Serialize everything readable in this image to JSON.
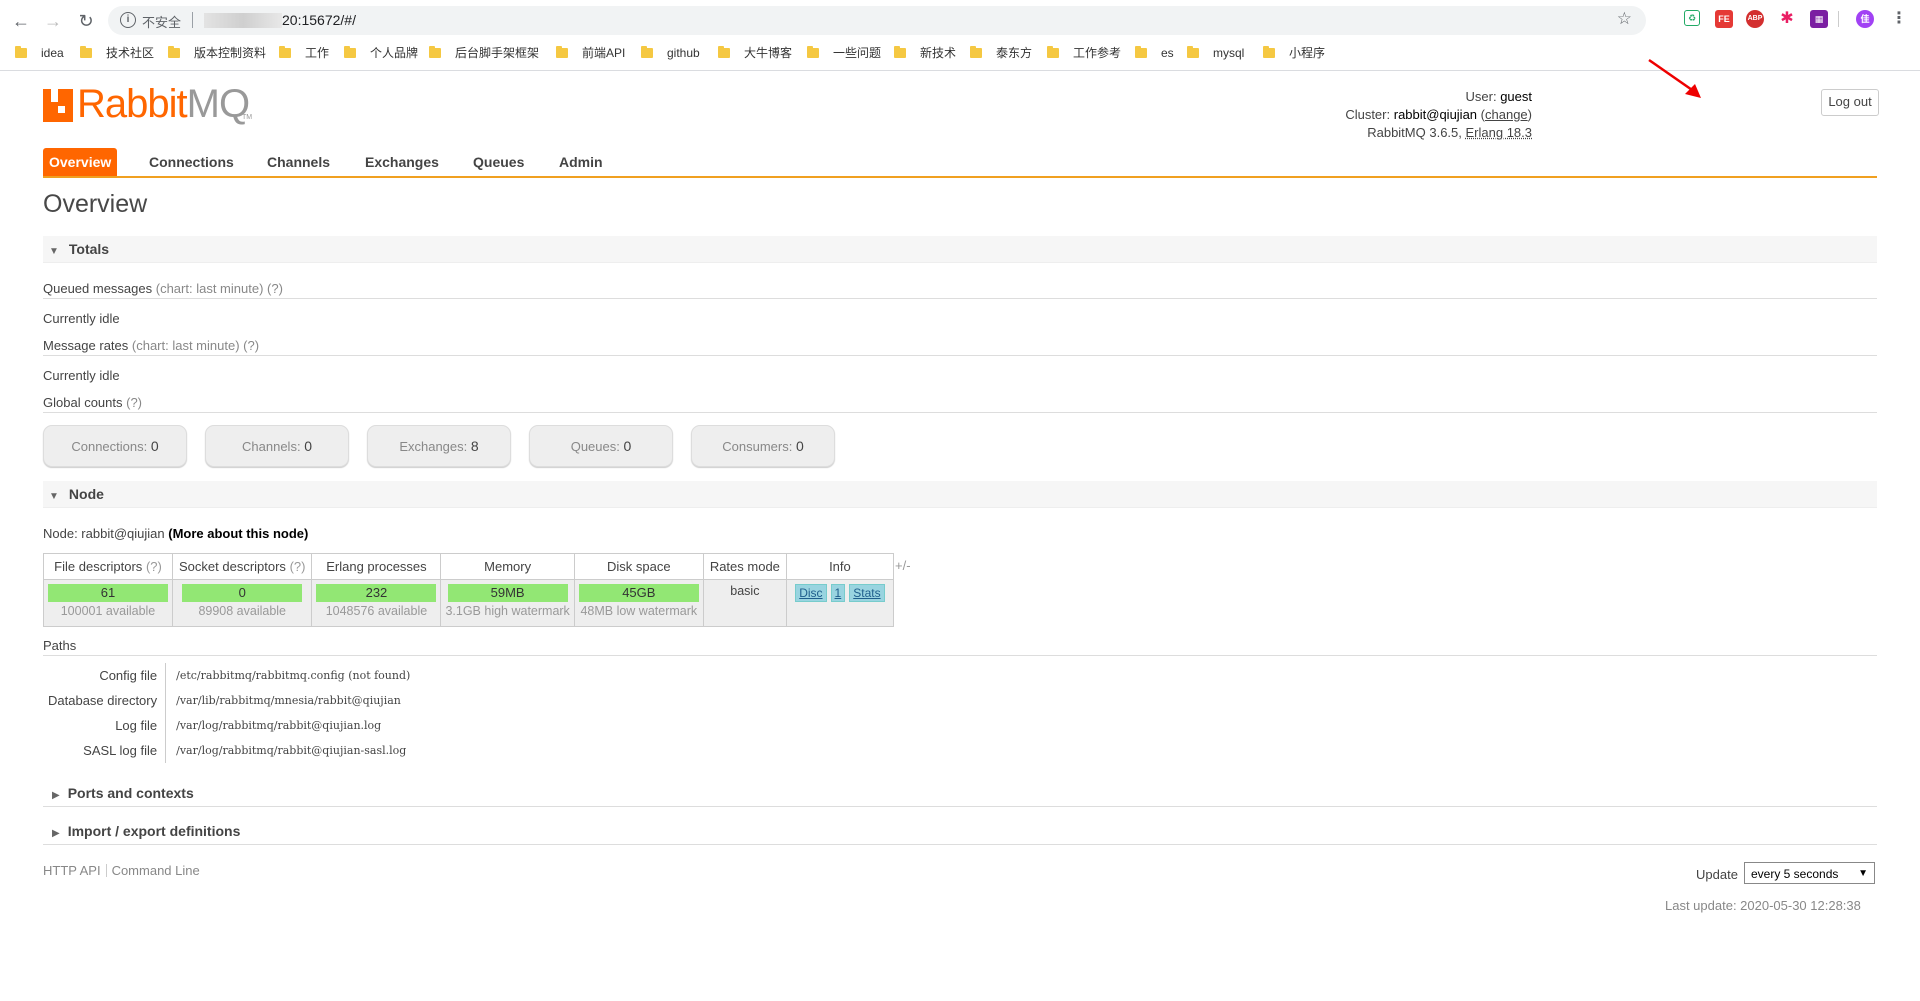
{
  "browser": {
    "security_label": "不安全",
    "url": "20:15672/#/",
    "back_icon": "back-arrow-icon",
    "forward_icon": "forward-arrow-icon",
    "reload_icon": "reload-icon",
    "bookmarks": [
      "idea",
      "技术社区",
      "版本控制资料",
      "工作",
      "个人品牌",
      "后台脚手架框架",
      "前端API",
      "github",
      "大牛博客",
      "一些问题",
      "新技术",
      "泰东方",
      "工作参考",
      "es",
      "mysql",
      "小程序"
    ],
    "extensions": {
      "fe_label": "FE",
      "abp_label": "ABP",
      "avatar_letter": "佳"
    }
  },
  "app": {
    "brand": "RabbitMQ",
    "brand_part1": "Rabbit",
    "brand_part2": "MQ",
    "trademark": "TM",
    "user_label": "User:",
    "user": "guest",
    "cluster_label": "Cluster:",
    "cluster": "rabbit@qiujian",
    "change_link": "change",
    "version_text": "RabbitMQ 3.6.5,",
    "erlang": "Erlang 18.3",
    "logout": "Log out",
    "tabs": [
      "Overview",
      "Connections",
      "Channels",
      "Exchanges",
      "Queues",
      "Admin"
    ],
    "page_title": "Overview"
  },
  "totals": {
    "header": "Totals",
    "queued_label": "Queued messages",
    "queued_hint": "(chart: last minute) (?)",
    "queued_status": "Currently idle",
    "rates_label": "Message rates",
    "rates_hint": "(chart: last minute) (?)",
    "rates_status": "Currently idle",
    "global_label": "Global counts",
    "global_hint": "(?)",
    "counts": [
      {
        "label": "Connections:",
        "value": "0"
      },
      {
        "label": "Channels:",
        "value": "0"
      },
      {
        "label": "Exchanges:",
        "value": "8"
      },
      {
        "label": "Queues:",
        "value": "0"
      },
      {
        "label": "Consumers:",
        "value": "0"
      }
    ]
  },
  "node": {
    "header": "Node",
    "node_label": "Node: rabbit@qiujian",
    "more_link": "(More about this node)",
    "columns": [
      "File descriptors",
      "Socket descriptors",
      "Erlang processes",
      "Memory",
      "Disk space",
      "Rates mode",
      "Info"
    ],
    "hint": "(?)",
    "file_descriptors": {
      "value": "61",
      "sub": "100001 available"
    },
    "socket_descriptors": {
      "value": "0",
      "sub": "89908 available"
    },
    "erlang_processes": {
      "value": "232",
      "sub": "1048576 available"
    },
    "memory": {
      "value": "59MB",
      "sub": "3.1GB high watermark"
    },
    "disk_space": {
      "value": "45GB",
      "sub": "48MB low watermark"
    },
    "rates_mode": "basic",
    "info": [
      "Disc",
      "1",
      "Stats"
    ],
    "plus_minus": "+/-"
  },
  "paths": {
    "header": "Paths",
    "rows": [
      {
        "label": "Config file",
        "value": "/etc/rabbitmq/rabbitmq.config (not found)"
      },
      {
        "label": "Database directory",
        "value": "/var/lib/rabbitmq/mnesia/rabbit@qiujian"
      },
      {
        "label": "Log file",
        "value": "/var/log/rabbitmq/rabbit@qiujian.log"
      },
      {
        "label": "SASL log file",
        "value": "/var/log/rabbitmq/rabbit@qiujian-sasl.log"
      }
    ]
  },
  "collapsed_sections": [
    "Ports and contexts",
    "Import / export definitions"
  ],
  "footer": {
    "http_api": "HTTP API",
    "command_line": "Command Line",
    "update_label": "Update",
    "update_value": "every 5 seconds",
    "last_update": "Last update: 2020-05-30 12:28:38"
  }
}
